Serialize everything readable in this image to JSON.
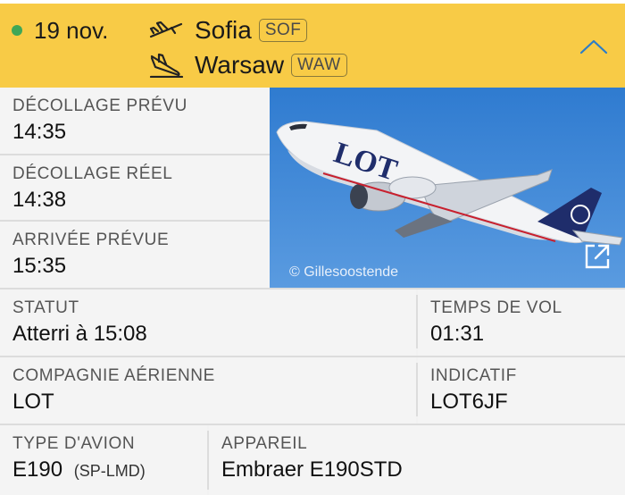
{
  "header": {
    "date": "19 nov.",
    "status_color": "#3fa757",
    "accent_color": "#f8cb46",
    "departure": {
      "city": "Sofia",
      "code": "SOF",
      "icon": "takeoff-icon"
    },
    "arrival": {
      "city": "Warsaw",
      "code": "WAW",
      "icon": "landing-icon"
    },
    "collapse_icon": "chevron-up-icon"
  },
  "times": {
    "scheduled_departure": {
      "label": "DÉCOLLAGE PRÉVU",
      "value": "14:35"
    },
    "actual_departure": {
      "label": "DÉCOLLAGE RÉEL",
      "value": "14:38"
    },
    "scheduled_arrival": {
      "label": "ARRIVÉE PRÉVUE",
      "value": "15:35"
    }
  },
  "photo": {
    "credit": "© Gillesoostende",
    "livery_text": "LOT",
    "expand_icon": "external-link-icon"
  },
  "details": {
    "status": {
      "label": "STATUT",
      "value": "Atterri à 15:08"
    },
    "flight_time": {
      "label": "TEMPS DE VOL",
      "value": "01:31"
    },
    "airline": {
      "label": "COMPAGNIE AÉRIENNE",
      "value": "LOT"
    },
    "callsign": {
      "label": "INDICATIF",
      "value": "LOT6JF"
    },
    "aircraft_type": {
      "label": "TYPE D'AVION",
      "value": "E190",
      "registration": "(SP-LMD)"
    },
    "aircraft": {
      "label": "APPAREIL",
      "value": "Embraer E190STD"
    }
  }
}
